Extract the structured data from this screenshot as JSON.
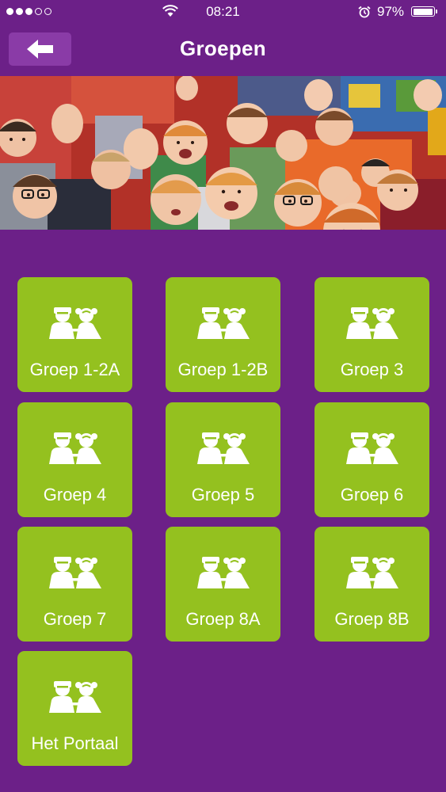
{
  "status_bar": {
    "time": "08:21",
    "battery_pct": "97%",
    "battery_level": 0.97,
    "signal_bars_filled": 3,
    "signal_bars_total": 5
  },
  "nav": {
    "title": "Groepen",
    "back_icon": "arrow-left-icon"
  },
  "hero": {
    "image": "photo-of-cheering-children"
  },
  "groups": [
    {
      "label": "Groep 1-2A",
      "icon": "children-icon"
    },
    {
      "label": "Groep 1-2B",
      "icon": "children-icon"
    },
    {
      "label": "Groep 3",
      "icon": "children-icon"
    },
    {
      "label": "Groep 4",
      "icon": "children-icon"
    },
    {
      "label": "Groep 5",
      "icon": "children-icon"
    },
    {
      "label": "Groep 6",
      "icon": "children-icon"
    },
    {
      "label": "Groep 7",
      "icon": "children-icon"
    },
    {
      "label": "Groep 8A",
      "icon": "children-icon"
    },
    {
      "label": "Groep 8B",
      "icon": "children-icon"
    },
    {
      "label": "Het Portaal",
      "icon": "children-icon"
    }
  ],
  "colors": {
    "background": "#6c2088",
    "tile": "#94c11f",
    "back_button": "#8a3ba7",
    "text": "#ffffff"
  }
}
